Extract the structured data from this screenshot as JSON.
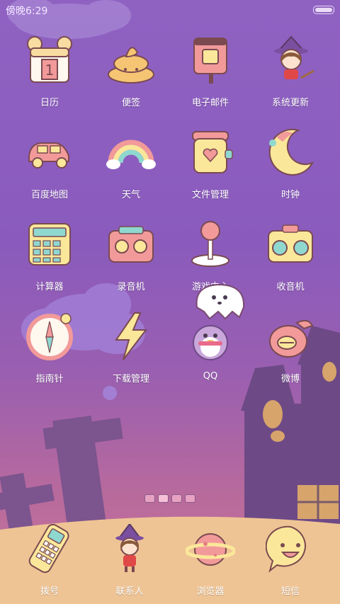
{
  "status_bar": {
    "time": "傍晚6:29"
  },
  "apps": [
    {
      "label": "日历",
      "icon": "calendar-icon"
    },
    {
      "label": "便签",
      "icon": "poop-note-icon"
    },
    {
      "label": "电子邮件",
      "icon": "mailbox-icon"
    },
    {
      "label": "系统更新",
      "icon": "witch-girl-icon"
    },
    {
      "label": "百度地图",
      "icon": "car-icon"
    },
    {
      "label": "天气",
      "icon": "rainbow-icon"
    },
    {
      "label": "文件管理",
      "icon": "jar-heart-icon"
    },
    {
      "label": "时钟",
      "icon": "crescent-moon-icon"
    },
    {
      "label": "计算器",
      "icon": "calculator-icon"
    },
    {
      "label": "录音机",
      "icon": "tape-recorder-icon"
    },
    {
      "label": "游戏中心",
      "icon": "joystick-icon"
    },
    {
      "label": "收音机",
      "icon": "radio-icon"
    },
    {
      "label": "指南针",
      "icon": "compass-icon"
    },
    {
      "label": "下载管理",
      "icon": "lightning-icon"
    },
    {
      "label": "QQ",
      "icon": "penguin-ghost-icon"
    },
    {
      "label": "微博",
      "icon": "weibo-eye-icon"
    }
  ],
  "dock": [
    {
      "label": "拨号",
      "icon": "phone-icon"
    },
    {
      "label": "联系人",
      "icon": "witch-girl-icon"
    },
    {
      "label": "浏览器",
      "icon": "planet-icon"
    },
    {
      "label": "短信",
      "icon": "smiley-bubble-icon"
    }
  ],
  "pager": {
    "pages": 4,
    "current_page": 2
  },
  "colors": {
    "background_top": "#8f62c2",
    "background_bottom": "#c9779a",
    "dock_ground": "#efc495",
    "icon_cream": "#fbe79a",
    "icon_pink": "#f29a9a",
    "icon_outline": "#7a4a50"
  }
}
